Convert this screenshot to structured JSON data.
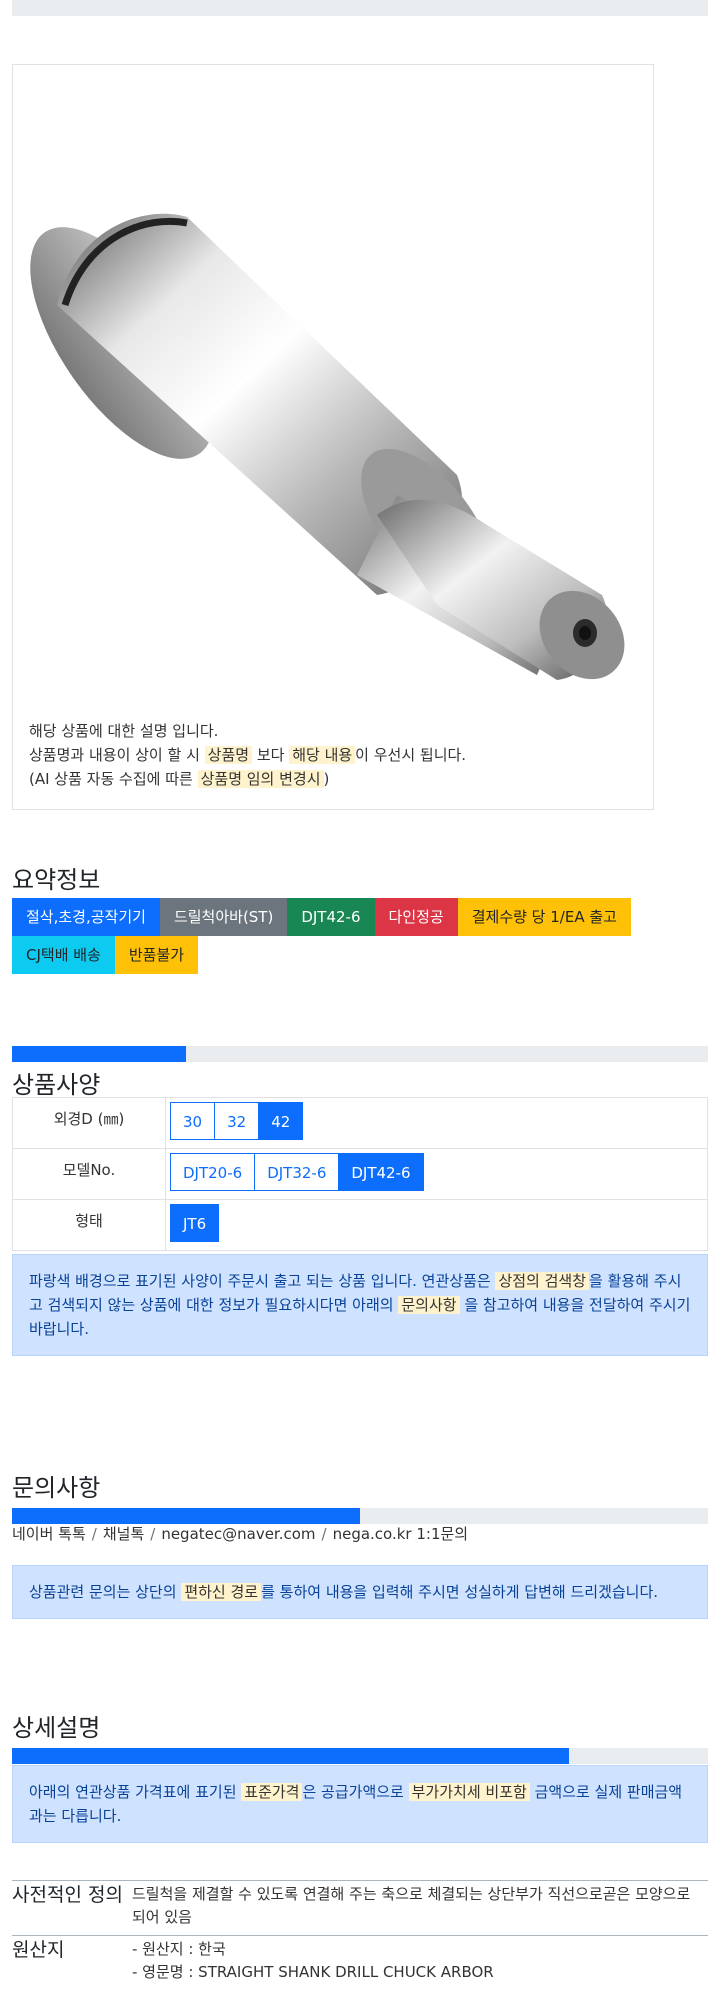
{
  "product": {
    "desc_line1": "해당 상품에 대한 설명 입니다.",
    "desc_line2_pre": "상품명과 내용이 상이 할 시 ",
    "desc_line2_hl1": "상품명",
    "desc_line2_mid": " 보다 ",
    "desc_line2_hl2": "해당 내용",
    "desc_line2_post": "이 우선시 됩니다.",
    "desc_line3_pre": "(AI 상품 자동 수집에 따른 ",
    "desc_line3_hl": "상품명 임의 변경시",
    "desc_line3_post": ")"
  },
  "summary": {
    "title": "요약정보",
    "badges": [
      {
        "label": "절삭,초경,공작기기",
        "color": "#0d6efd",
        "text": "#ffffff"
      },
      {
        "label": "드릴척아바(ST)",
        "color": "#6c757d",
        "text": "#ffffff"
      },
      {
        "label": "DJT42-6",
        "color": "#198754",
        "text": "#ffffff"
      },
      {
        "label": "다인정공",
        "color": "#dc3545",
        "text": "#ffffff"
      },
      {
        "label": "결제수량 당 1/EA 출고",
        "color": "#ffc107",
        "text": "#212529"
      },
      {
        "label": "CJ택배 배송",
        "color": "#0dcaf0",
        "text": "#212529"
      },
      {
        "label": "반품불가",
        "color": "#ffc107",
        "text": "#212529"
      }
    ]
  },
  "spec": {
    "title": "상품사양",
    "progress": 0.25,
    "rows": [
      {
        "label": "외경D (㎜)",
        "options": [
          "30",
          "32",
          "42"
        ],
        "selected": 2
      },
      {
        "label": "모델No.",
        "options": [
          "DJT20-6",
          "DJT32-6",
          "DJT42-6"
        ],
        "selected": 2
      },
      {
        "label": "형태",
        "options": [
          "JT6"
        ],
        "selected": 0
      }
    ],
    "notice_pre": "파랑색 배경으로 표기된 사양이 주문시 출고 되는 상품 입니다. 연관상품은 ",
    "notice_hl1": "상점의 검색창",
    "notice_mid": "을 활용해 주시고 검색되지 않는 상품에 대한 정보가 필요하시다면 아래의 ",
    "notice_hl2": "문의사항",
    "notice_post": " 을 참고하여 내용을 전달하여 주시기 바랍니다."
  },
  "inquiry": {
    "title": "문의사항",
    "progress": 0.5,
    "channels": [
      "네이버 톡톡",
      "채널톡",
      "negatec@naver.com",
      "nega.co.kr 1:1문의"
    ],
    "notice_pre": "상품관련 문의는 상단의 ",
    "notice_hl": "편하신 경로",
    "notice_post": "를 통하여 내용을 입력해 주시면 성실하게 답변해 드리겠습니다."
  },
  "detail": {
    "title": "상세설명",
    "progress": 0.8,
    "notice_pre": "아래의 연관상품 가격표에 표기된 ",
    "notice_hl1": "표준가격",
    "notice_mid": "은 공급가액으로 ",
    "notice_hl2": "부가가치세 비포함",
    "notice_post": " 금액으로 실제 판매금액과는 다릅니다.",
    "rows": [
      {
        "key": "사전적인 정의",
        "lines": [
          "드릴척을 제결할 수 있도록 연결해 주는 축으로 체결되는 상단부가 직선으로곧은 모양으로 되어 있음"
        ]
      },
      {
        "key": "원산지",
        "lines": [
          "- 원산지 : 한국",
          "- 영문명 : STRAIGHT SHANK DRILL CHUCK ARBOR"
        ]
      }
    ]
  }
}
